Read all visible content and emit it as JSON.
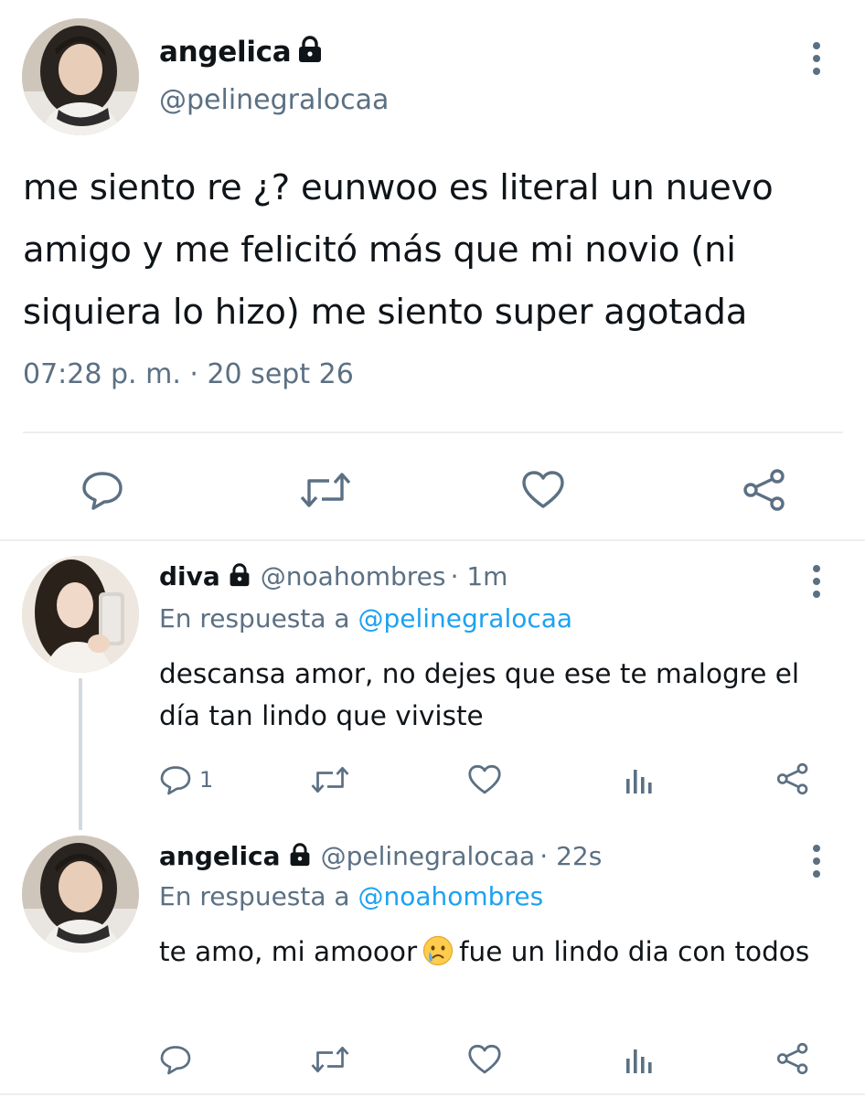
{
  "main_tweet": {
    "display_name": "angelica",
    "handle": "@pelinegralocaa",
    "text": "me siento re ¿? eunwoo es literal un nuevo amigo y me felicitó más que mi novio (ni siquiera lo hizo) me siento super agotada",
    "timestamp": "07:28 p. m. · 20 sept 26",
    "actions": [
      "reply-icon",
      "retweet-icon",
      "like-icon",
      "share-icon"
    ]
  },
  "replies": [
    {
      "display_name": "diva",
      "handle": "@noahombres",
      "time": "· 1m",
      "replying_prefix": "En respuesta a",
      "replying_to": "@pelinegralocaa",
      "text": "descansa amor, no dejes que ese te malogre el día tan lindo que viviste",
      "reply_count": "1"
    },
    {
      "display_name": "angelica",
      "handle": "@pelinegralocaa",
      "time": "· 22s",
      "replying_prefix": "En respuesta a",
      "replying_to": "@noahombres",
      "text_before_emoji": "te amo, mi amooor",
      "emoji": "crying-face-emoji",
      "text_after_emoji": "fue un lindo dia con todos"
    }
  ],
  "colors": {
    "text": "#0f1419",
    "secondary": "#5b7083",
    "mention": "#1da1f2",
    "divider": "#eceff1",
    "thread_line": "#d3dadf"
  }
}
